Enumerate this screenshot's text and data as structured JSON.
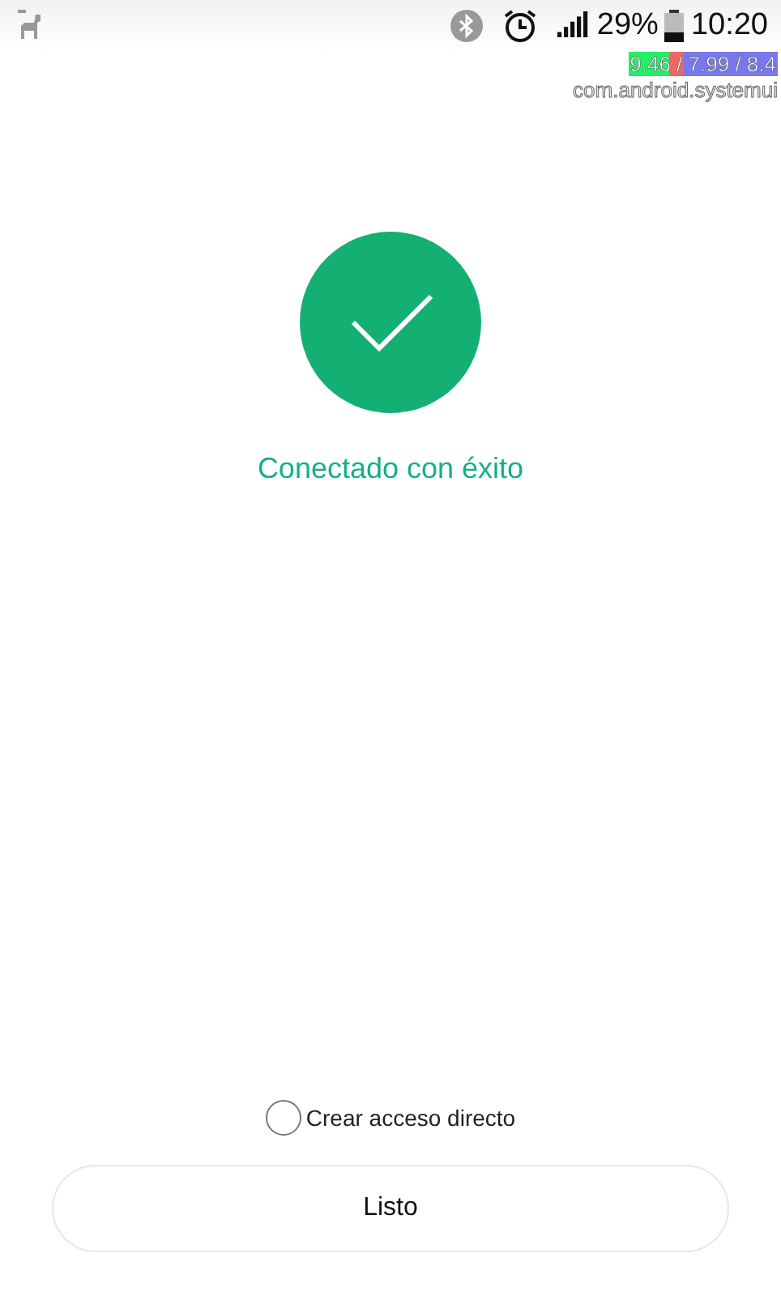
{
  "status_bar": {
    "battery_percent": "29%",
    "time": "10:20"
  },
  "debug_overlay": {
    "load": "9.46 / 7.99 / 8.4",
    "process": "com.android.systemui"
  },
  "result": {
    "message": "Conectado con éxito"
  },
  "shortcut_option": {
    "label": "Crear acceso directo",
    "checked": false
  },
  "buttons": [
    "Listo"
  ]
}
